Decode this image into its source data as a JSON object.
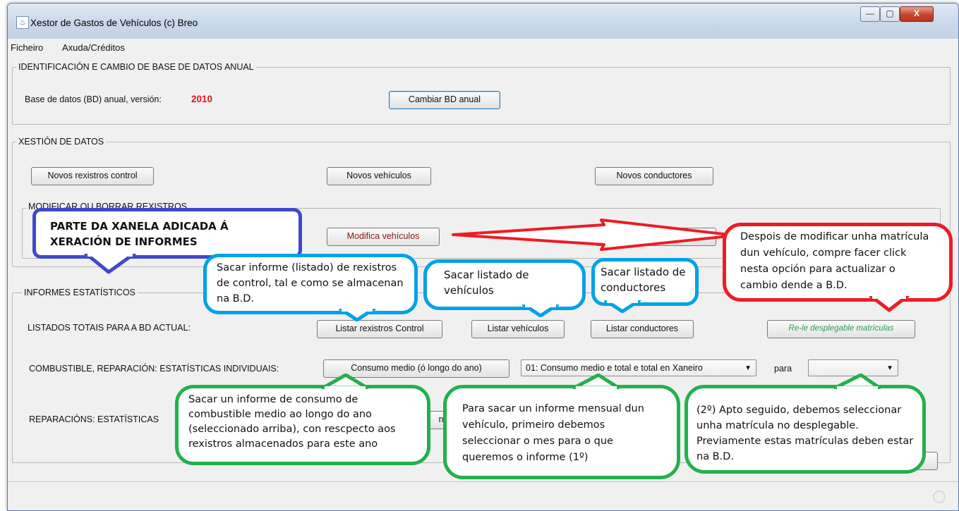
{
  "window": {
    "title": "Xestor de Gastos de Vehículos (c) Breo",
    "icon": "java-app-icon",
    "controls": {
      "minimize": "—",
      "maximize": "▢",
      "close": "X"
    }
  },
  "menu": {
    "items": [
      "Ficheiro",
      "Axuda/Créditos"
    ]
  },
  "db_panel": {
    "title": "IDENTIFICACIÓN E CAMBIO DE BASE DE DATOS ANUAL",
    "label": "Base de datos (BD) anual, versión:",
    "version": "2010",
    "version_color": "#e0151b",
    "change_button": "Cambiar BD anual"
  },
  "data_panel": {
    "title": "XESTIÓN DE DATOS",
    "buttons": [
      "Novos rexistros control",
      "Novos vehículos",
      "Novos conductores"
    ],
    "modify_title": "MODIFICAR OU BORRAR REXISTROS",
    "modify_button": "Modifica vehículos",
    "modify_button_color": "#8b1a1a"
  },
  "reports_panel": {
    "title": "INFORMES ESTATÍSTICOS",
    "row1_label": "LISTADOS TOTAIS PARA A BD ACTUAL:",
    "row1_buttons": [
      "Listar rexistros Control",
      "Listar vehículos",
      "Listar conductores"
    ],
    "reload_button": "Re-le desplegable matrículas",
    "reload_color": "#2e9b57",
    "row2_label": "COMBUSTIBLE, REPARACIÓN: ESTATÍSTICAS INDIVIDUAIS:",
    "row2_button": "Consumo medio (ó longo do ano)",
    "month_select": "01: Consumo medio e total e total en Xaneiro",
    "para_label": "para",
    "plate_select": "",
    "row3_label": "REPARACIÓNS: ESTATÍSTICAS",
    "row3_partial": "n (c"
  },
  "callouts": {
    "blue_title": {
      "text": "PARTE DA XANELA ADICADA Á XERACIÓN DE INFORMES",
      "color": "#3f48cc"
    },
    "control": {
      "text": "Sacar informe (listado) de rexistros de control, tal e como se almacenan na B.D.",
      "color": "#00a2e8"
    },
    "vehicles": {
      "text": "Sacar listado de vehículos",
      "color": "#00a2e8"
    },
    "drivers": {
      "text": "Sacar listado de conductores",
      "color": "#00a2e8"
    },
    "reload": {
      "text": "Despois de modificar unha matrícula dun vehículo, compre facer click nesta opción para actualizar o cambio dende a B.D.",
      "color": "#ed1c24"
    },
    "consumption": {
      "text": "Sacar un informe de consumo de combustible medio ao longo do ano (seleccionado arriba), con rescpecto aos rexistros almacenados para este ano",
      "color": "#22b14c"
    },
    "monthly": {
      "text": "Para sacar un informe mensual dun vehículo, primeiro debemos seleccionar o mes para o que queremos o informe (1º)",
      "color": "#22b14c"
    },
    "plate": {
      "text": "(2º) Apto seguido, debemos seleccionar unha matrícula no desplegable. Previamente estas matrículas deben estar na B.D.",
      "color": "#22b14c"
    }
  }
}
